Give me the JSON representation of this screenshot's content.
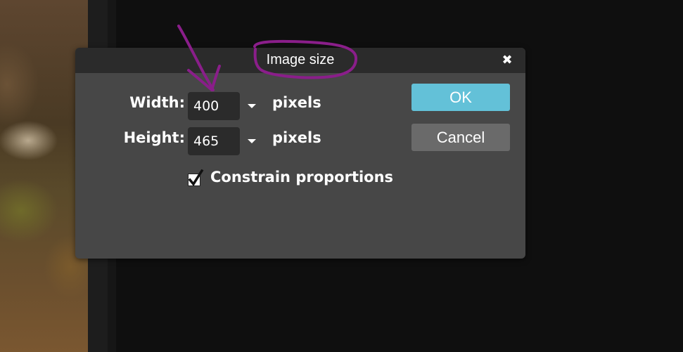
{
  "dialog": {
    "title": "Image size",
    "close_glyph": "✖",
    "width": {
      "label": "Width:",
      "value": "400",
      "unit": "pixels"
    },
    "height": {
      "label": "Height:",
      "value": "465",
      "unit": "pixels"
    },
    "constrain": {
      "label": "Constrain proportions",
      "checked": true
    },
    "ok_label": "OK",
    "cancel_label": "Cancel"
  },
  "colors": {
    "dialog_bg": "#474747",
    "titlebar_bg": "#2b2b2b",
    "input_bg": "#2b2b2b",
    "ok_bg": "#63c1d8",
    "cancel_bg": "#6a6a6a",
    "annotation": "#8a1e8a"
  },
  "icons": {
    "close": "close-icon",
    "dropdown": "chevron-down-icon",
    "checkbox": "check-icon"
  }
}
